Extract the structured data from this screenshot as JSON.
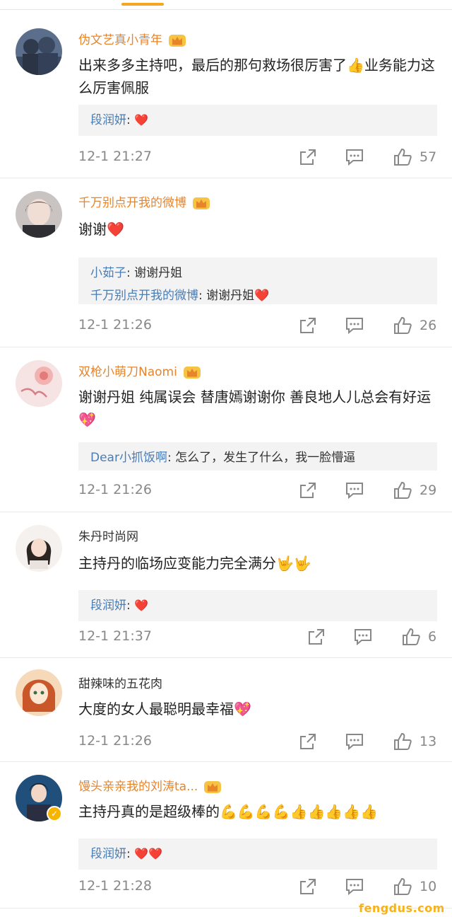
{
  "comments": [
    {
      "user": "伪文艺真小青年",
      "text": "出来多多主持吧，最后的那句救场很厉害了👍业务能力这么厉害佩服",
      "replies": [
        {
          "user": "段润妍",
          "text": "❤️"
        }
      ],
      "time": "12-1 21:27",
      "likes": "57"
    },
    {
      "user": "千万别点开我的微博",
      "text": "谢谢❤️",
      "replies": [
        {
          "user": "小茹子",
          "text": "谢谢丹姐"
        },
        {
          "user": "千万别点开我的微博",
          "text": "谢谢丹姐❤️"
        }
      ],
      "time": "12-1 21:26",
      "likes": "26"
    },
    {
      "user": "双枪小萌刀Naomi",
      "text": "谢谢丹姐 纯属误会 替唐嫣谢谢你 善良地人儿总会有好运💖",
      "replies": [
        {
          "user": "Dear小抓饭啊",
          "text": "怎么了，发生了什么，我一脸懵逼"
        }
      ],
      "time": "12-1 21:26",
      "likes": "29"
    },
    {
      "user": "朱丹时尚网",
      "text": "主持丹的临场应变能力完全满分🤟🤟",
      "replies": [
        {
          "user": "段润妍",
          "text": "❤️"
        }
      ],
      "time": "12-1 21:37",
      "likes": "6"
    },
    {
      "user": "甜辣味的五花肉",
      "text": "大度的女人最聪明最幸福💖",
      "replies": [],
      "time": "12-1 21:26",
      "likes": "13"
    },
    {
      "user": "馒头亲亲我的刘涛ta...",
      "text": "主持丹真的是超级棒的💪💪💪💪👍👍👍👍👍",
      "replies": [
        {
          "user": "段润妍",
          "text": "❤️❤️"
        }
      ],
      "time": "12-1 21:28",
      "likes": "10"
    }
  ],
  "reply_separator": ":",
  "watermark": "fengdus.com",
  "colors": {
    "vip_name": "#e8842a",
    "reply_name": "#4a7cb5",
    "heart": "#e8323c",
    "tab_indicator": "#f5a623"
  },
  "icons": [
    "crown-badge-icon",
    "share-icon",
    "comment-icon",
    "like-icon",
    "verified-icon"
  ]
}
